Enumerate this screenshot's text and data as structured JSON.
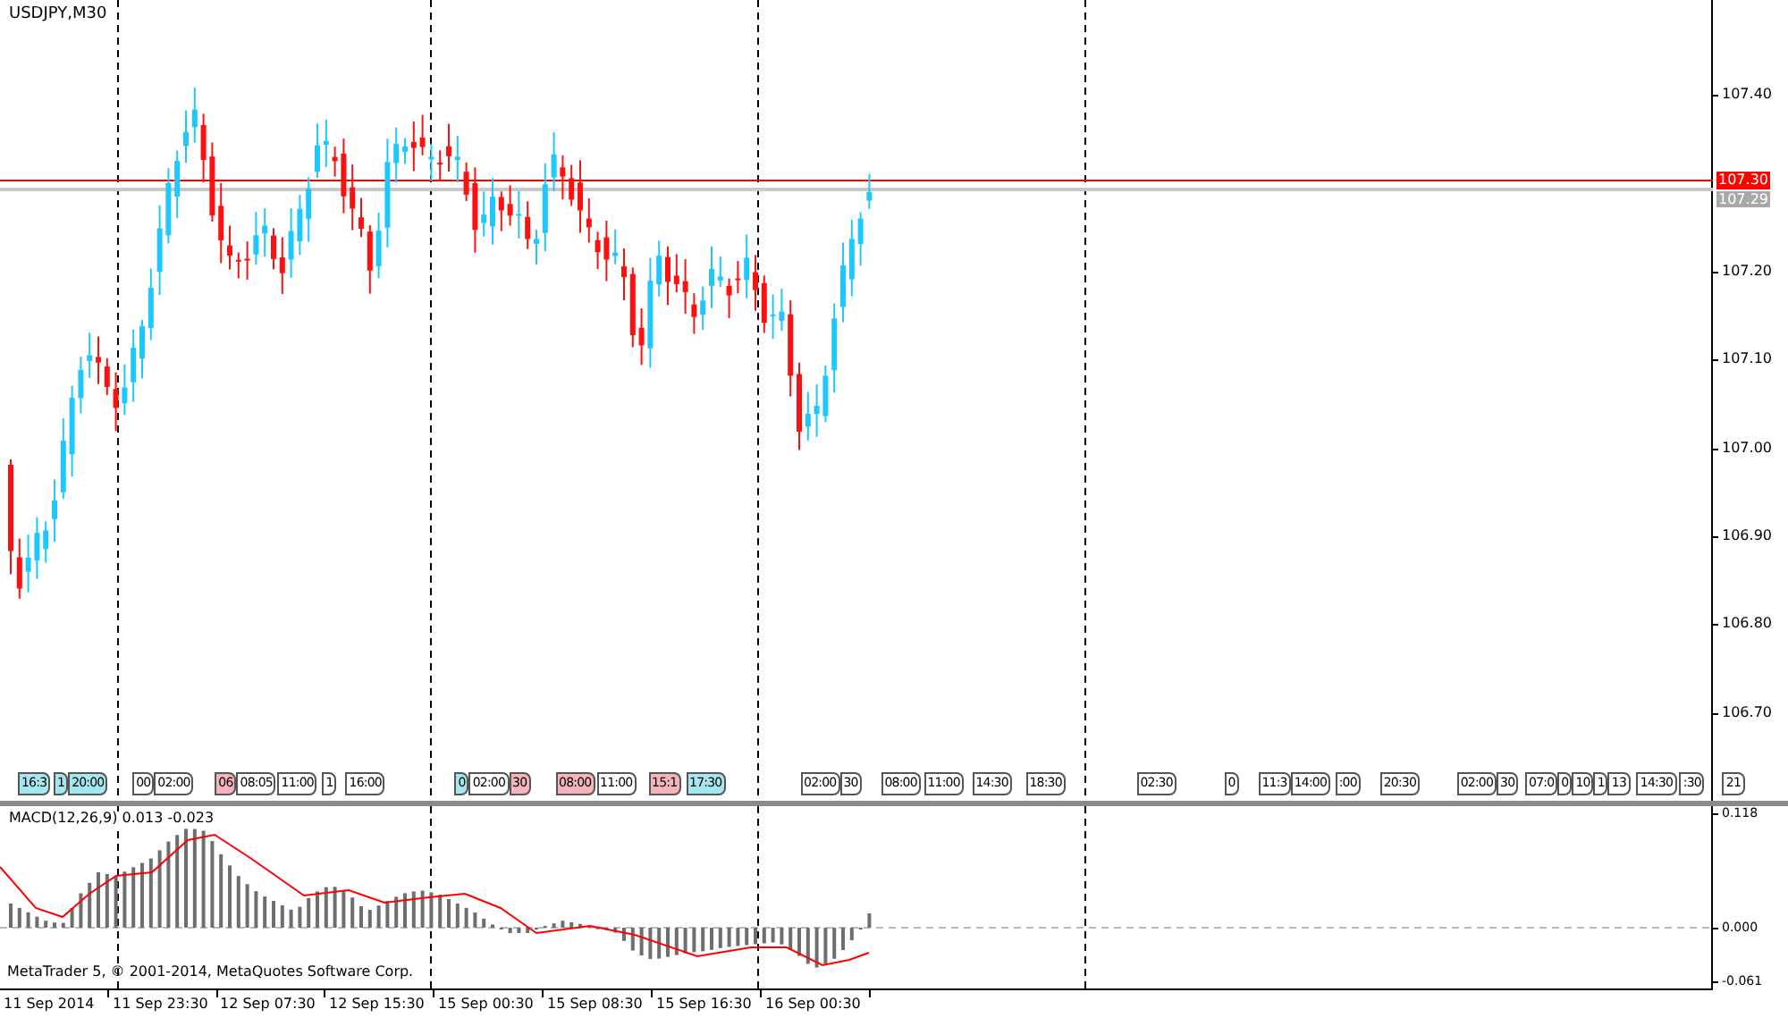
{
  "symbol_label": "USDJPY,M30",
  "price_axis": {
    "ticks": [
      "107.40",
      "107.20",
      "107.10",
      "107.00",
      "106.90",
      "106.80",
      "106.70"
    ],
    "bid_label": "107.30",
    "ask_label": "107.29"
  },
  "time_tags": [
    {
      "text": "16:3",
      "color": "#a6e6ee"
    },
    {
      "text": "1",
      "color": "#a6e6ee"
    },
    {
      "text": "20:00",
      "color": "#a6e6ee"
    },
    {
      "text": "00",
      "color": "#ffffff"
    },
    {
      "text": "02:00",
      "color": "#ffffff"
    },
    {
      "text": "06",
      "color": "#f4b4bc"
    },
    {
      "text": "08:05",
      "color": "#ffffff"
    },
    {
      "text": "11:00",
      "color": "#ffffff"
    },
    {
      "text": "1",
      "color": "#ffffff"
    },
    {
      "text": "16:00",
      "color": "#ffffff"
    },
    {
      "text": "0",
      "color": "#a6e6ee"
    },
    {
      "text": "02:00",
      "color": "#ffffff"
    },
    {
      "text": "30",
      "color": "#f4b4bc"
    },
    {
      "text": "08:00",
      "color": "#f4b4bc"
    },
    {
      "text": "11:00",
      "color": "#ffffff"
    },
    {
      "text": "15:1",
      "color": "#f4b4bc"
    },
    {
      "text": "17:30",
      "color": "#a6e6ee"
    },
    {
      "text": "02:00",
      "color": "#ffffff"
    },
    {
      "text": "30",
      "color": "#ffffff"
    },
    {
      "text": "08:00",
      "color": "#ffffff"
    },
    {
      "text": "11:00",
      "color": "#ffffff"
    },
    {
      "text": "14:30",
      "color": "#ffffff"
    },
    {
      "text": "18:30",
      "color": "#ffffff"
    },
    {
      "text": "02:30",
      "color": "#ffffff"
    },
    {
      "text": "0",
      "color": "#ffffff"
    },
    {
      "text": "11:3",
      "color": "#ffffff"
    },
    {
      "text": "14:00",
      "color": "#ffffff"
    },
    {
      "text": ":00",
      "color": "#ffffff"
    },
    {
      "text": "20:30",
      "color": "#ffffff"
    },
    {
      "text": "02:00",
      "color": "#ffffff"
    },
    {
      "text": "30",
      "color": "#ffffff"
    },
    {
      "text": "07:0",
      "color": "#ffffff"
    },
    {
      "text": "0",
      "color": "#ffffff"
    },
    {
      "text": "10",
      "color": "#ffffff"
    },
    {
      "text": "1",
      "color": "#ffffff"
    },
    {
      "text": "13",
      "color": "#ffffff"
    },
    {
      "text": "14:30",
      "color": "#ffffff"
    },
    {
      "text": ":30",
      "color": "#ffffff"
    },
    {
      "text": "21",
      "color": "#ffffff"
    }
  ],
  "indicator": {
    "label": "MACD(12,26,9) 0.013 -0.023",
    "axis_ticks": [
      "0.118",
      "0.000",
      "-0.061"
    ]
  },
  "copyright": "MetaTrader 5, © 2001-2014, MetaQuotes Software Corp.",
  "time_axis": [
    "11 Sep 2014",
    "11 Sep 23:30",
    "12 Sep 07:30",
    "12 Sep 15:30",
    "15 Sep 00:30",
    "15 Sep 08:30",
    "15 Sep 16:30",
    "16 Sep 00:30"
  ]
}
